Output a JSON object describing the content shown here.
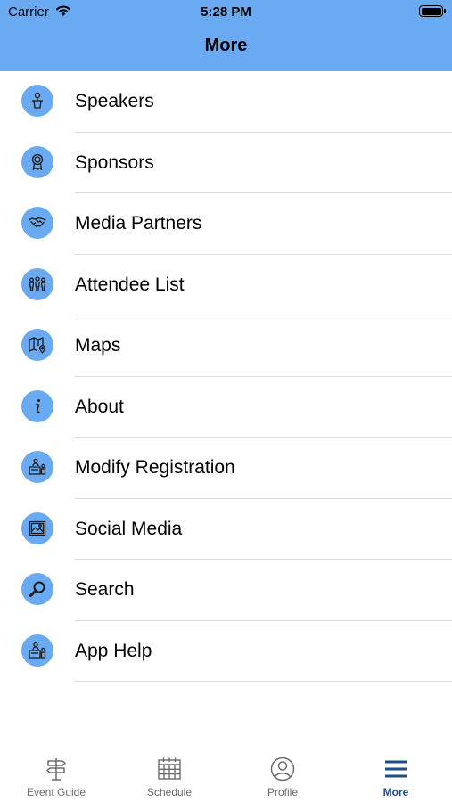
{
  "status_bar": {
    "carrier": "Carrier",
    "time": "5:28 PM"
  },
  "header": {
    "title": "More"
  },
  "colors": {
    "accent": "#6aaaf2",
    "active_tab": "#1b4e8c",
    "divider": "#dcdcdc"
  },
  "menu": {
    "items": [
      {
        "label": "Speakers",
        "icon": "speaker-podium-icon"
      },
      {
        "label": "Sponsors",
        "icon": "award-ribbon-icon"
      },
      {
        "label": "Media Partners",
        "icon": "handshake-icon"
      },
      {
        "label": "Attendee List",
        "icon": "people-group-icon"
      },
      {
        "label": "Maps",
        "icon": "map-pin-icon"
      },
      {
        "label": "About",
        "icon": "info-icon"
      },
      {
        "label": "Modify Registration",
        "icon": "registration-desk-icon"
      },
      {
        "label": "Social Media",
        "icon": "image-icon"
      },
      {
        "label": "Search",
        "icon": "search-icon"
      },
      {
        "label": "App Help",
        "icon": "help-desk-icon"
      }
    ]
  },
  "tabbar": {
    "tabs": [
      {
        "label": "Event Guide",
        "icon": "signpost-icon",
        "active": false
      },
      {
        "label": "Schedule",
        "icon": "calendar-icon",
        "active": false
      },
      {
        "label": "Profile",
        "icon": "profile-icon",
        "active": false
      },
      {
        "label": "More",
        "icon": "menu-icon",
        "active": true
      }
    ]
  }
}
